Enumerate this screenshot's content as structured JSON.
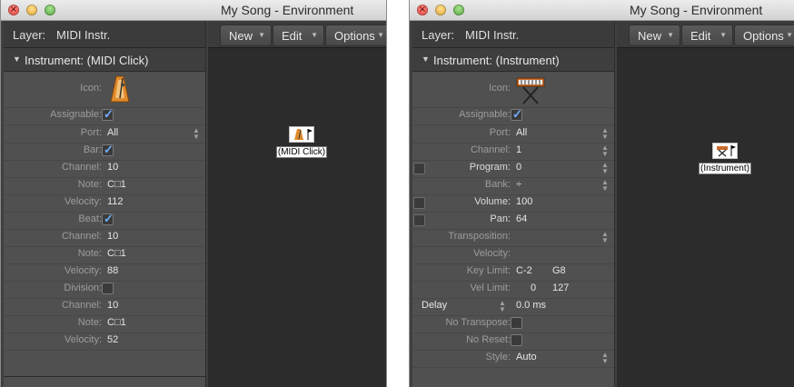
{
  "windows": [
    {
      "title": "My Song - Environment",
      "layer": {
        "label": "Layer:",
        "value": "MIDI Instr."
      },
      "section": "Instrument: (MIDI Click)",
      "toolbar": {
        "new": "New",
        "edit": "Edit",
        "options": "Options"
      },
      "params": {
        "icon_label": "Icon:",
        "assignable": "Assignable:",
        "port": "Port:",
        "port_value": "All",
        "bar": "Bar:",
        "bar_channel": "Channel:",
        "bar_channel_value": "10",
        "bar_note": "Note:",
        "bar_note_value": "C□1",
        "bar_velocity": "Velocity:",
        "bar_velocity_value": "112",
        "beat": "Beat:",
        "beat_channel": "Channel:",
        "beat_channel_value": "10",
        "beat_note": "Note:",
        "beat_note_value": "C□1",
        "beat_velocity": "Velocity:",
        "beat_velocity_value": "88",
        "division": "Division:",
        "div_channel": "Channel:",
        "div_channel_value": "10",
        "div_note": "Note:",
        "div_note_value": "C□1",
        "div_velocity": "Velocity:",
        "div_velocity_value": "52"
      },
      "canvas_object": {
        "label": "(MIDI Click)",
        "icon": "metronome-icon"
      }
    },
    {
      "title": "My Song - Environment",
      "layer": {
        "label": "Layer:",
        "value": "MIDI Instr."
      },
      "section": "Instrument: (Instrument)",
      "toolbar": {
        "new": "New",
        "edit": "Edit",
        "options": "Options"
      },
      "params": {
        "icon_label": "Icon:",
        "assignable": "Assignable:",
        "port": "Port:",
        "port_value": "All",
        "channel": "Channel:",
        "channel_value": "1",
        "program": "Program:",
        "program_value": "0",
        "bank": "Bank:",
        "bank_value": "÷",
        "volume": "Volume:",
        "volume_value": "100",
        "pan": "Pan:",
        "pan_value": "64",
        "transposition": "Transposition:",
        "velocity": "Velocity:",
        "key_limit": "Key Limit:",
        "key_limit_low": "C-2",
        "key_limit_high": "G8",
        "vel_limit": "Vel Limit:",
        "vel_limit_low": "0",
        "vel_limit_high": "127",
        "delay": "Delay",
        "delay_value": "0.0 ms",
        "no_transpose": "No Transpose:",
        "no_reset": "No Reset:",
        "style": "Style:",
        "style_value": "Auto"
      },
      "canvas_object": {
        "label": "(Instrument)",
        "icon": "keyboard-stand-icon"
      }
    }
  ],
  "colors": {
    "checkmark": "#6fb0ff",
    "metronome": "#e08a2c"
  }
}
